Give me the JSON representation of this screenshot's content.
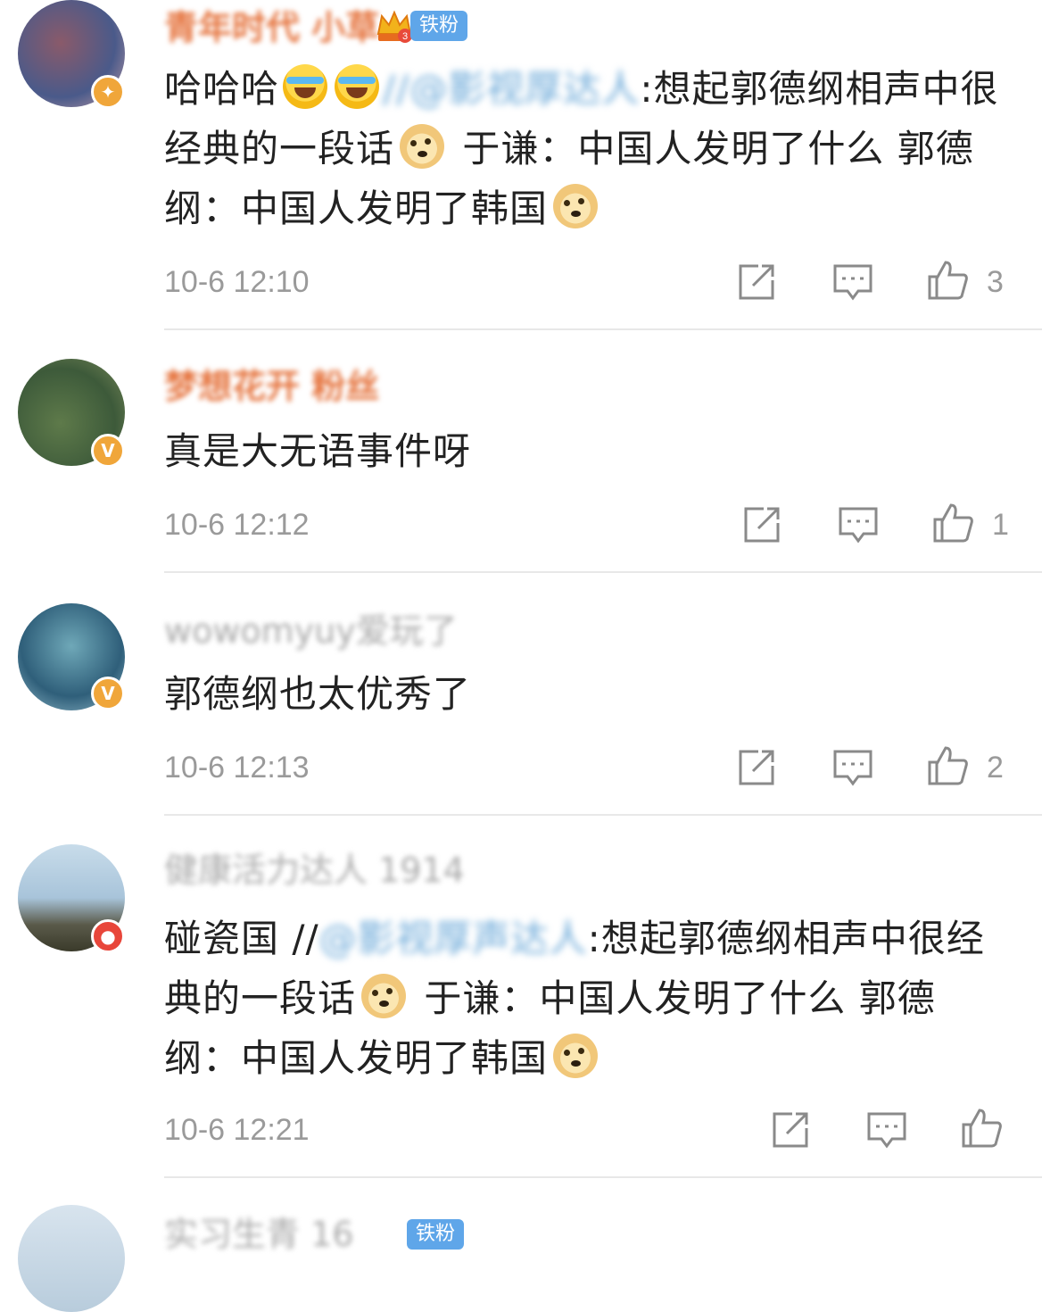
{
  "colors": {
    "timestamp": "#9a9a9a",
    "verified_badge": "#f0a63a",
    "fan_badge": "#5fa6e9",
    "username": "#e5733d"
  },
  "comments": [
    {
      "username": "青年时代 小草",
      "badge": "铁粉",
      "badge_level": "3",
      "text_prefix": "哈哈哈",
      "mention": "//@影视厚达人",
      "text_main": ":想起郭德纲相声中很经典的一段话",
      "text_rest": " 于谦：中国人发明了什么 郭德纲：中国人发明了韩国",
      "timestamp": "10-6 12:10",
      "likes": "3"
    },
    {
      "username": "梦想花开 粉丝",
      "text": "真是大无语事件呀",
      "timestamp": "10-6 12:12",
      "likes": "1"
    },
    {
      "username": "wowomyuy爱玩了",
      "text": "郭德纲也太优秀了",
      "timestamp": "10-6 12:13",
      "likes": "2"
    },
    {
      "username": "健康活力达人 1914",
      "text_prefix": "碰瓷国 //",
      "mention": "@影视厚声达人",
      "text_main": ":想起郭德纲相声中很经典的一段话",
      "text_rest": " 于谦：中国人发明了什么 郭德纲：中国人发明了韩国",
      "timestamp": "10-6 12:21",
      "likes": ""
    },
    {
      "username": "实习生青 16",
      "badge": "铁粉"
    }
  ]
}
